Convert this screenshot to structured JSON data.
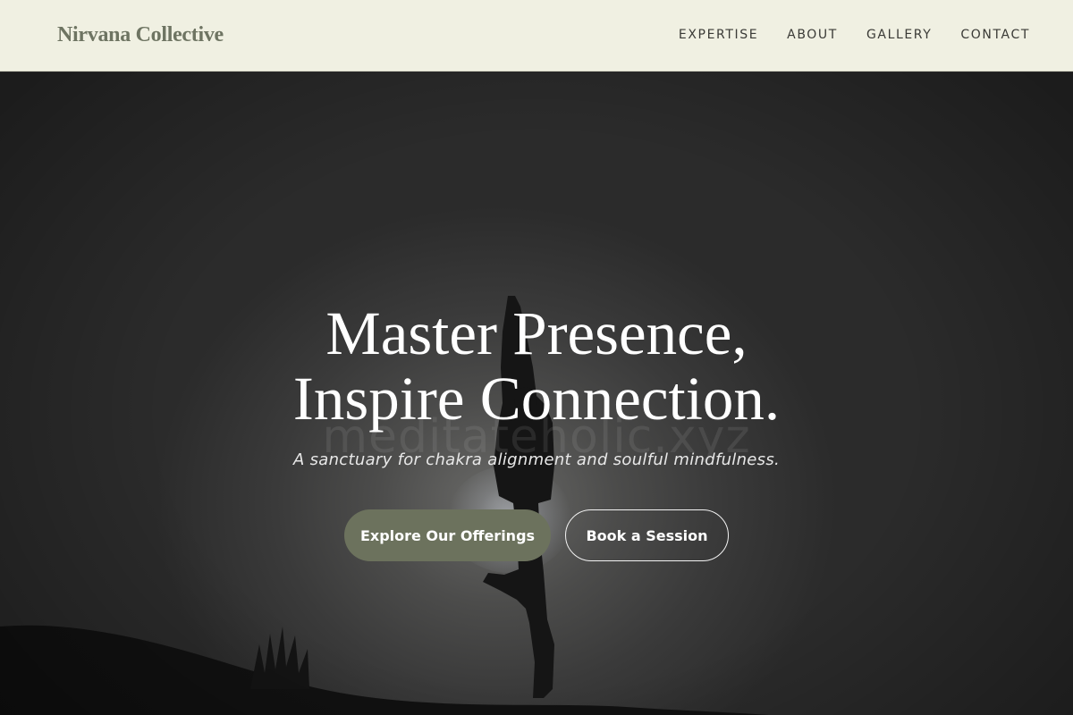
{
  "header": {
    "brand": "Nirvana Collective",
    "nav": [
      "EXPERTISE",
      "ABOUT",
      "GALLERY",
      "CONTACT"
    ]
  },
  "hero": {
    "headline_line1": "Master Presence,",
    "headline_line2": "Inspire Connection.",
    "watermark": "meditateholic.xyz",
    "tagline": "A sanctuary for chakra alignment and soulful mindfulness.",
    "primary_button": "Explore Our Offerings",
    "secondary_button": "Book a Session"
  },
  "colors": {
    "header_bg": "#f0f0e2",
    "brand": "#6e7462",
    "primary_button": "#6c725d"
  }
}
